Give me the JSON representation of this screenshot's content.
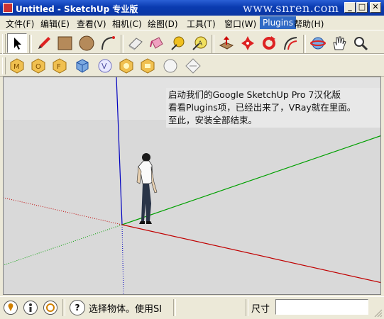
{
  "window": {
    "title": "Untitled - SketchUp 专业版",
    "watermark": "www.snren.com",
    "minimize_glyph": "_",
    "maximize_glyph": "□",
    "close_glyph": "✕"
  },
  "menu": {
    "items": [
      {
        "label": "文件(F)"
      },
      {
        "label": "编辑(E)"
      },
      {
        "label": "查看(V)"
      },
      {
        "label": "相机(C)"
      },
      {
        "label": "绘图(D)"
      },
      {
        "label": "工具(T)"
      },
      {
        "label": "窗口(W)"
      },
      {
        "label": "Plugins",
        "active": true
      },
      {
        "label": "帮助(H)"
      }
    ]
  },
  "toolbar1": {
    "tools": [
      "select-arrow-icon",
      "pencil-icon",
      "rectangle-icon",
      "circle-icon",
      "arc-icon",
      "eraser-icon",
      "paint-bucket-icon",
      "tape-measure-icon",
      "text-icon",
      "push-pull-icon",
      "move-icon",
      "rotate-icon",
      "offset-icon",
      "orbit-icon",
      "pan-hand-icon",
      "zoom-icon"
    ]
  },
  "toolbar2": {
    "tools": [
      "vray-material-icon",
      "vray-options-icon",
      "vray-frame-buffer-icon",
      "vray-sphere-icon",
      "vray-logo-icon",
      "vray-omni-light-icon",
      "vray-rect-light-icon",
      "vray-white-sphere-icon",
      "vray-plane-icon"
    ]
  },
  "note": {
    "line1": "启动我们的Google SketchUp Pro 7汉化版",
    "line2": "看看Plugins项，已经出来了，VRay就在里面。",
    "line3": "至此，安装全部结束。"
  },
  "colors": {
    "title_bar": "#0a3bb0",
    "menu_highlight": "#316ac5",
    "viewport_bg": "#d9d9d9",
    "axis_red": "#c00000",
    "axis_green": "#00a000",
    "axis_blue": "#0000c0"
  },
  "statusbar": {
    "geo_icon": "geo-location-icon",
    "credits_icon": "credits-icon",
    "user_icon": "user-icon",
    "help_glyph": "?",
    "status_text": "选择物体。使用SI",
    "measure_label": "尺寸",
    "measure_value": ""
  }
}
